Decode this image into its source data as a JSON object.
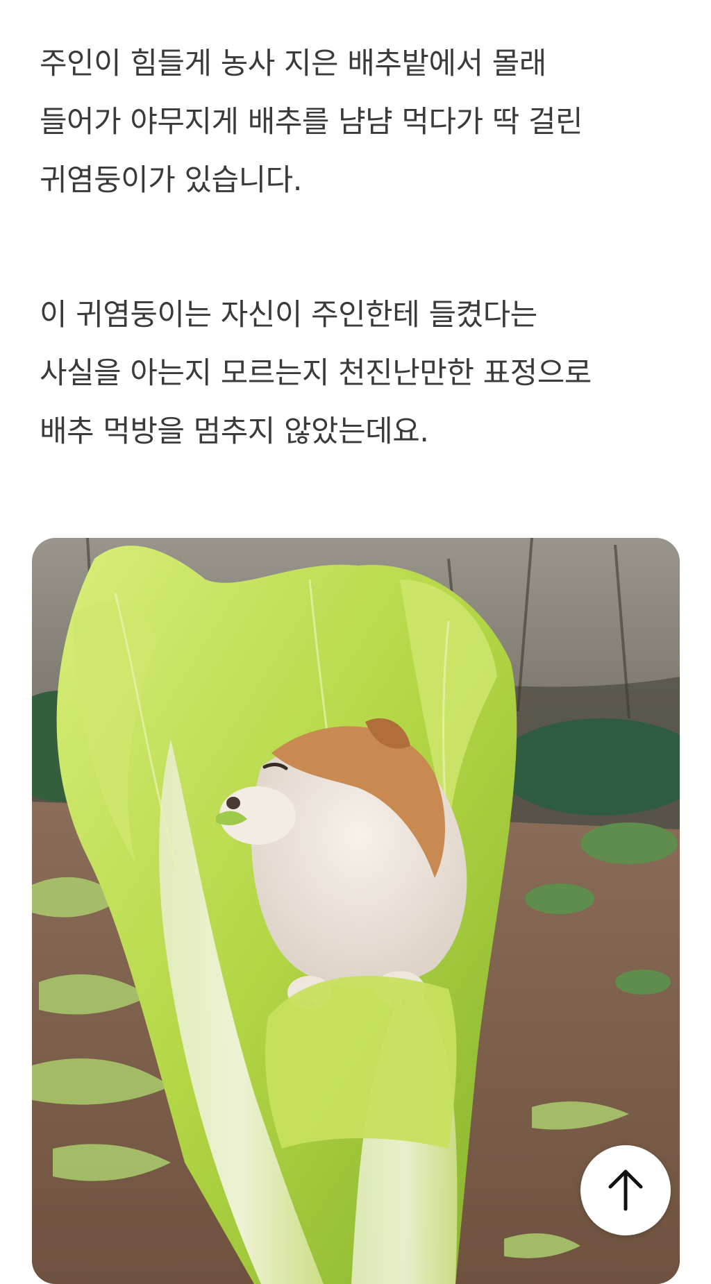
{
  "article": {
    "paragraphs": [
      {
        "lines": [
          "주인이 힘들게 농사 지은 배추밭에서 몰래",
          "들어가 야무지게 배추를 냠냠 먹다가 딱 걸린",
          "귀염둥이가 있습니다."
        ]
      },
      {
        "lines": [
          "이 귀염둥이는 자신이 주인한테 들켰다는",
          "사실을 아는지 모르는지 천진난만한 표정으로",
          "배추 먹방을 멈추지 않았는데요."
        ]
      }
    ],
    "photo": {
      "subject": "puppy-eating-napa-cabbage"
    }
  },
  "controls": {
    "scroll_top_icon": "arrow-up-icon"
  },
  "colors": {
    "text": "#3a3a3a",
    "background": "#ffffff",
    "cabbage": "#b6d84a",
    "puppy_fur": "#c98a52",
    "soil": "#7a5a44"
  }
}
